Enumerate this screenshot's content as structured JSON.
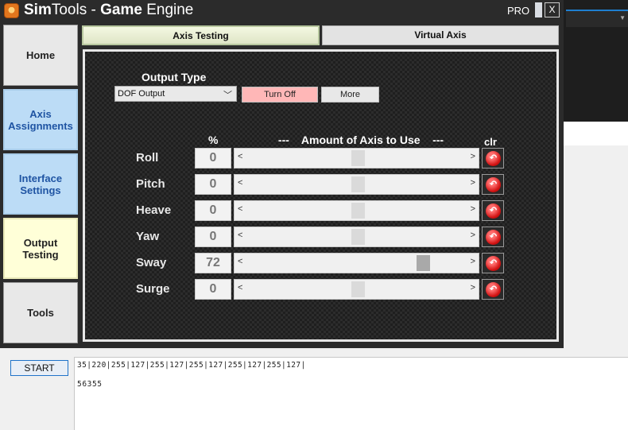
{
  "window": {
    "title_part1": "Sim",
    "title_part2": "Tools - ",
    "title_part3": "Game",
    "title_part4": " Engine",
    "pro_label": "PRO",
    "close_label": "X"
  },
  "nav": {
    "home": "Home",
    "axis_assignments": [
      "Axis",
      "Assignments"
    ],
    "interface_settings": [
      "Interface",
      "Settings"
    ],
    "output_testing": [
      "Output",
      "Testing"
    ],
    "tools": "Tools"
  },
  "tabs": {
    "axis_testing": "Axis Testing",
    "virtual_axis": "Virtual Axis"
  },
  "panel": {
    "output_type_label": "Output Type",
    "output_type_value": "DOF Output",
    "turn_off_label": "Turn Off",
    "more_label": "More",
    "percent_header": "%",
    "amount_header": "---    Amount of Axis to Use    ---",
    "clr_header": "clr",
    "axes": [
      {
        "label": "Roll",
        "value": "0",
        "level": 0
      },
      {
        "label": "Pitch",
        "value": "0",
        "level": 0
      },
      {
        "label": "Heave",
        "value": "0",
        "level": 0
      },
      {
        "label": "Yaw",
        "value": "0",
        "level": 0
      },
      {
        "label": "Sway",
        "value": "72",
        "level": 72
      },
      {
        "label": "Surge",
        "value": "0",
        "level": 0
      }
    ]
  },
  "bottom": {
    "start_label": "START",
    "log_line1": "35|220|255|127|255|127|255|127|255|127|255|127|",
    "log_line2": "56355"
  }
}
